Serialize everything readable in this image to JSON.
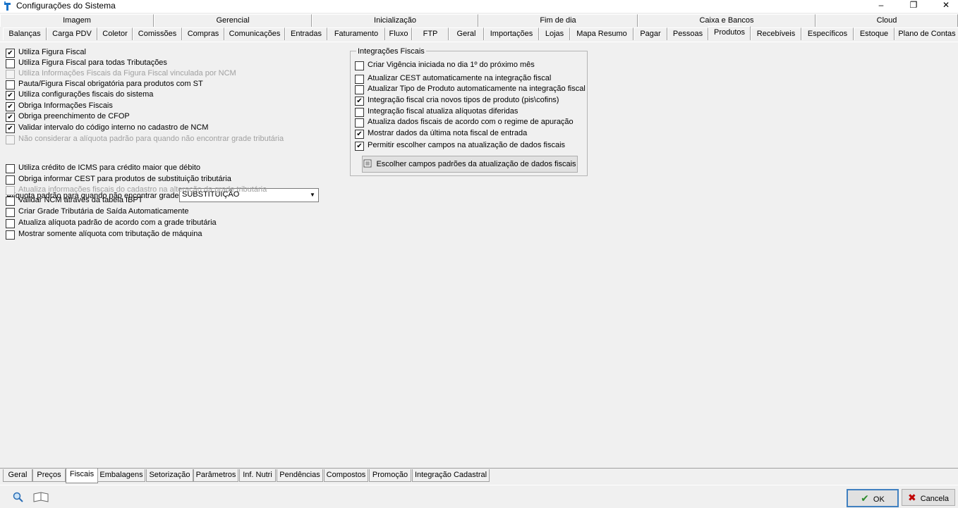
{
  "window": {
    "title": "Configurações do Sistema",
    "minimize_icon": "minimize-icon",
    "maximize_icon": "restore-icon",
    "close_icon": "close-icon"
  },
  "tabs_top": [
    "Imagem",
    "Gerencial",
    "Inicialização",
    "Fim de dia",
    "Caixa e Bancos",
    "Cloud"
  ],
  "tabs_row2": [
    "Balanças",
    "Carga PDV",
    "Coletor",
    "Comissões",
    "Compras",
    "Comunicações",
    "Entradas",
    "Faturamento",
    "Fluxo",
    "FTP",
    "Geral",
    "Importações",
    "Lojas",
    "Mapa Resumo",
    "Pagar",
    "Pessoas",
    "Produtos",
    "Recebíveis",
    "Específicos",
    "Estoque",
    "Plano de Contas"
  ],
  "tabs_row2_active": "Produtos",
  "left_checks": [
    {
      "label": "Utiliza Figura Fiscal",
      "checked": true,
      "disabled": false
    },
    {
      "label": "Utiliza Figura Fiscal para todas Tributações",
      "checked": false,
      "disabled": false
    },
    {
      "label": "Utiliza Informações Fiscais da Figura Fiscal vinculada por NCM",
      "checked": false,
      "disabled": true
    },
    {
      "label": "Pauta/Figura Fiscal obrigatória para produtos com ST",
      "checked": false,
      "disabled": false
    },
    {
      "label": "Utiliza configurações fiscais do sistema",
      "checked": true,
      "disabled": false
    },
    {
      "label": "Obriga Informações Fiscais",
      "checked": true,
      "disabled": false
    },
    {
      "label": "Obriga preenchimento de CFOP",
      "checked": true,
      "disabled": false
    },
    {
      "label": "Validar intervalo do código interno no cadastro de NCM",
      "checked": true,
      "disabled": false
    },
    {
      "label": "Não considerar a alíquota padrão para quando não encontrar grade tributária",
      "checked": false,
      "disabled": true
    }
  ],
  "aliquota": {
    "label": "Alíquota padrão para quando não encontrar grade:",
    "value": "SUBSTITUIÇÃO"
  },
  "left_checks2": [
    {
      "label": "Utiliza crédito de ICMS para crédito maior que débito",
      "checked": false,
      "disabled": false
    },
    {
      "label": "Obriga informar CEST para produtos de substituição tributária",
      "checked": false,
      "disabled": false
    },
    {
      "label": "Atualiza informações fiscais do cadastro na alteração da grade tributária",
      "checked": false,
      "disabled": true
    },
    {
      "label": "Validar NCM através da tabela IBPT",
      "checked": false,
      "disabled": false
    },
    {
      "label": "Criar Grade Tributária de Saída Automaticamente",
      "checked": false,
      "disabled": false
    },
    {
      "label": "Atualiza alíquota padrão de acordo com a grade tributária",
      "checked": false,
      "disabled": false
    },
    {
      "label": "Mostrar somente alíquota com tributação de máquina",
      "checked": false,
      "disabled": false
    }
  ],
  "integracoes": {
    "legend": "Integrações Fiscais",
    "checks": [
      {
        "label": "Criar Vigência iniciada no dia 1º do próximo mês",
        "checked": false
      },
      {
        "label": "Atualizar CEST automaticamente na integração fiscal",
        "checked": false
      },
      {
        "label": "Atualizar Tipo de Produto automaticamente na integração fiscal",
        "checked": false
      },
      {
        "label": "Integração fiscal cria novos tipos de produto (pis\\cofins)",
        "checked": true
      },
      {
        "label": "Integração fiscal atualiza alíquotas diferidas",
        "checked": false
      },
      {
        "label": "Atualiza dados fiscais de acordo com o regime de apuração",
        "checked": false
      },
      {
        "label": "Mostrar dados da última nota fiscal de entrada",
        "checked": true
      },
      {
        "label": "Permitir escolher campos na atualização de dados fiscais",
        "checked": true
      }
    ],
    "button_label": "Escolher campos padrões da atualização de dados fiscais"
  },
  "bottom_tabs": [
    "Geral",
    "Preços",
    "Fiscais",
    "Embalagens",
    "Setorização",
    "Parâmetros",
    "Inf. Nutri",
    "Pendências",
    "Compostos",
    "Promoção",
    "Integração Cadastral"
  ],
  "bottom_tabs_active": "Fiscais",
  "footer": {
    "ok_label": "OK",
    "cancel_label": "Cancela"
  },
  "colors": {
    "ok_icon": "#2e8b2e",
    "cancel_icon": "#c00000",
    "app_icon": "#1a73c8"
  }
}
